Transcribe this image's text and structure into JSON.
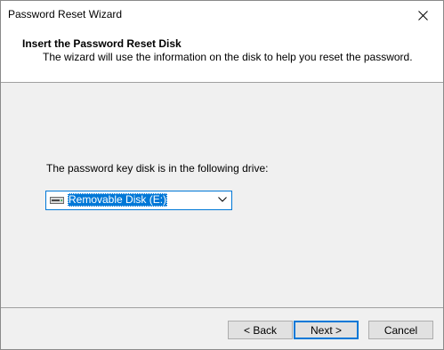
{
  "window": {
    "title": "Password Reset Wizard",
    "close_icon": "close-icon"
  },
  "header": {
    "title": "Insert the Password Reset Disk",
    "description": "The wizard will use the information on the disk to help you reset the password."
  },
  "main": {
    "drive_label": "The password key disk is in the following drive:",
    "drive_select": {
      "selected": "Removable Disk (E:)",
      "icon": "removable-drive-icon"
    }
  },
  "footer": {
    "back_label": "< Back",
    "next_label": "Next >",
    "cancel_label": "Cancel"
  },
  "colors": {
    "accent": "#0078d7",
    "dialog_bg": "#f0f0f0",
    "button_bg": "#e1e1e1"
  }
}
